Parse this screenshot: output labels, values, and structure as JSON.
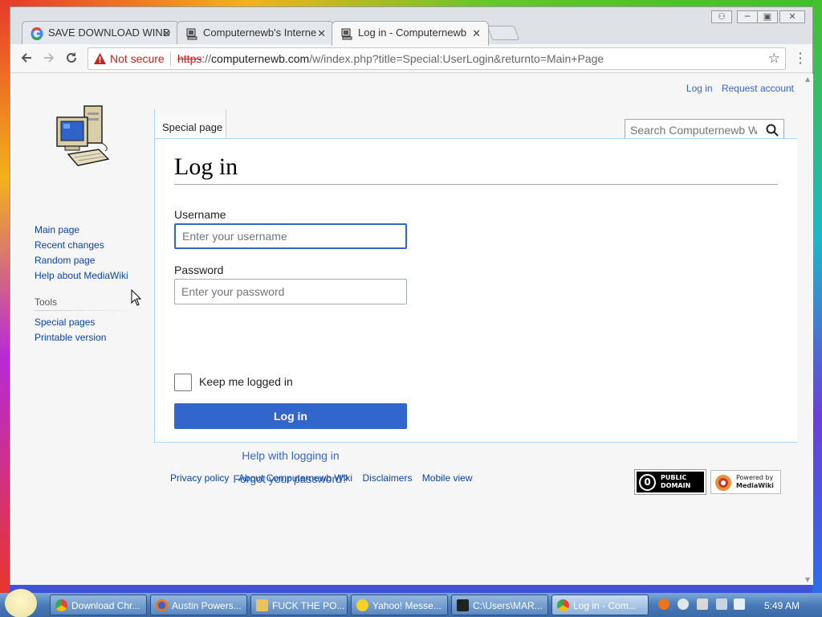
{
  "browser": {
    "tabs": [
      {
        "label": "SAVE DOWNLOAD WIND",
        "icon": "google-icon"
      },
      {
        "label": "Computernewb's Interne",
        "icon": "computernewb-icon"
      },
      {
        "label": "Log in - Computernewb",
        "icon": "computernewb-icon",
        "active": true
      }
    ],
    "tab_close": "✕",
    "window_controls": {
      "user": "⚇",
      "minimize": "─",
      "maximize": "▣",
      "close": "✕"
    },
    "not_secure": "Not secure",
    "url_scheme": "https",
    "url_sep": "://",
    "url_host": "computernewb.com",
    "url_path": "/w/index.php?title=Special:UserLogin&returnto=Main+Page"
  },
  "page": {
    "personal": {
      "login": "Log in",
      "request_account": "Request account"
    },
    "special_tab": "Special page",
    "search_placeholder": "Search Computernewb Wiki",
    "nav": [
      "Main page",
      "Recent changes",
      "Random page",
      "Help about MediaWiki"
    ],
    "tools_heading": "Tools",
    "tools": [
      "Special pages",
      "Printable version"
    ],
    "title": "Log in",
    "username_label": "Username",
    "username_placeholder": "Enter your username",
    "password_label": "Password",
    "password_placeholder": "Enter your password",
    "keep_logged_in": "Keep me logged in",
    "login_button": "Log in",
    "help_link": "Help with logging in",
    "forgot_link": "Forgot your password?",
    "footer": [
      "Privacy policy",
      "About Computernewb Wiki",
      "Disclaimers",
      "Mobile view"
    ],
    "badge_pd": {
      "line1": "PUBLIC",
      "line2": "DOMAIN",
      "mark": "0"
    },
    "badge_mw": {
      "line1": "Powered by",
      "line2": "MediaWiki"
    }
  },
  "taskbar": {
    "tasks": [
      {
        "label": "Download Chr...",
        "icon": "chrome-icon"
      },
      {
        "label": "Austin Powers...",
        "icon": "firefox-icon"
      },
      {
        "label": "FUCK THE PO...",
        "icon": "folder-icon"
      },
      {
        "label": "Yahoo! Messe...",
        "icon": "yahoo-messenger-icon"
      },
      {
        "label": "C:\\Users\\MAR...",
        "icon": "7zip-icon"
      },
      {
        "label": "Log in - Com...",
        "icon": "chrome-icon",
        "active": true
      }
    ],
    "clock": "5:49 AM"
  },
  "colors": {
    "accent": "#3366cc",
    "link": "#0645ad",
    "not_secure": "#c5221f"
  }
}
